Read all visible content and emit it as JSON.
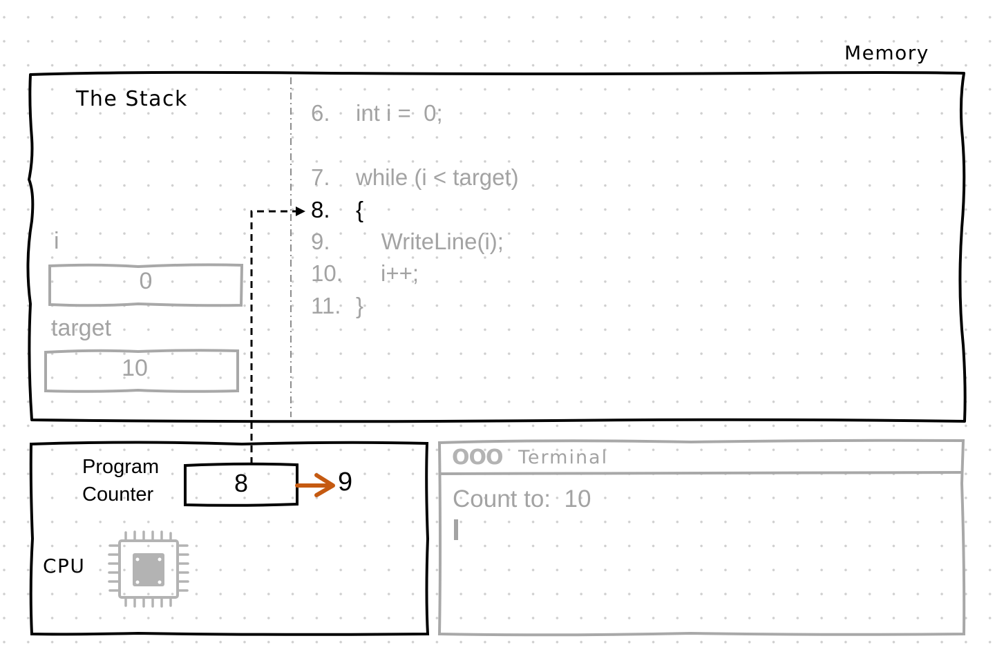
{
  "memory": {
    "title": "Memory",
    "stack": {
      "title": "The Stack",
      "variables": [
        {
          "name": "i",
          "value": "0"
        },
        {
          "name": "target",
          "value": "10"
        }
      ]
    },
    "code": [
      {
        "line": "6.",
        "text": "int i =  0;",
        "active": false
      },
      {
        "line": "7.",
        "text": "while (i < target)",
        "active": false
      },
      {
        "line": "8.",
        "text": "{",
        "active": true
      },
      {
        "line": "9.",
        "text": "    WriteLine(i);",
        "active": false
      },
      {
        "line": "10.",
        "text": "i++;",
        "active": false
      },
      {
        "line": "11.",
        "text": "}",
        "active": false
      }
    ]
  },
  "cpu": {
    "label": "CPU",
    "program_counter": {
      "label_line1": "Program",
      "label_line2": "Counter",
      "value": "8",
      "next_value": "9"
    },
    "icon": "cpu-chip-icon"
  },
  "terminal": {
    "title": "Terminal",
    "window_buttons": "OOO",
    "output": [
      {
        "prompt": "Count to:",
        "input": "10"
      }
    ],
    "cursor": "I"
  },
  "colors": {
    "ink": "#000000",
    "muted": "#a3a3a3",
    "accent_arrow": "#c55a11"
  }
}
